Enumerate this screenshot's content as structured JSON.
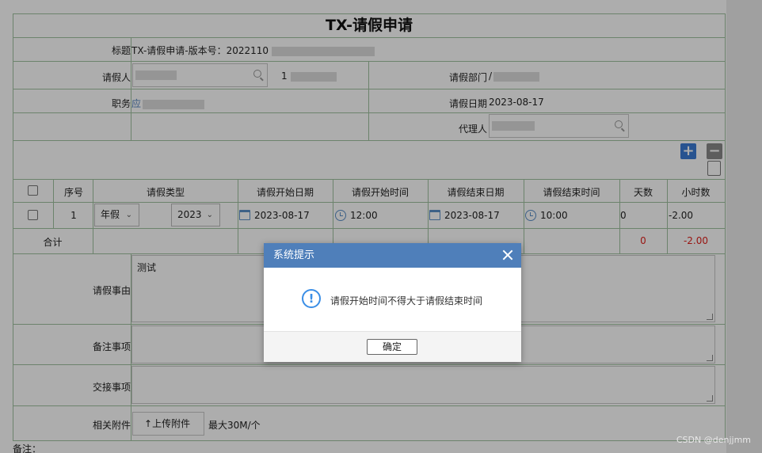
{
  "form": {
    "title": "TX-请假申请",
    "title_label": "标题",
    "title_value": "TX-请假申请-版本号：2022110",
    "applicant_label": "请假人",
    "applicant_value": "",
    "applicant_id": "1",
    "dept_label": "请假部门",
    "dept_value": "/",
    "position_label": "职务",
    "position_value": "应",
    "date_label": "请假日期",
    "date_value": "2023-08-17",
    "agent_label": "代理人"
  },
  "toolbar": {
    "add_label": "+",
    "remove_label": "−"
  },
  "table": {
    "headers": [
      "序号",
      "请假类型",
      "请假开始日期",
      "请假开始时间",
      "请假结束日期",
      "请假结束时间",
      "天数",
      "小时数"
    ],
    "row": {
      "seq": "1",
      "type": "年假",
      "year": "2023",
      "start_date": "2023-08-17",
      "start_time": "12:00",
      "end_date": "2023-08-17",
      "end_time": "10:00",
      "days": "0",
      "hours": "-2.00"
    },
    "total_label": "合计",
    "total_days": "0",
    "total_hours": "-2.00"
  },
  "reason": {
    "label": "请假事由",
    "value": "测试"
  },
  "remarks_label": "备注事项",
  "handover_label": "交接事项",
  "attachment": {
    "label": "相关附件",
    "button": "上传附件",
    "hint": "最大30M/个"
  },
  "footer_note": "备注：",
  "dialog": {
    "title": "系统提示",
    "message": "请假开始时间不得大于请假结束时间",
    "ok": "确定"
  },
  "watermark": "CSDN @denjjmm",
  "colors": {
    "border": "#9fc29f",
    "dialog_header": "#4f7fba",
    "negative": "#e0201b",
    "icon_blue": "#3a8ee6"
  }
}
